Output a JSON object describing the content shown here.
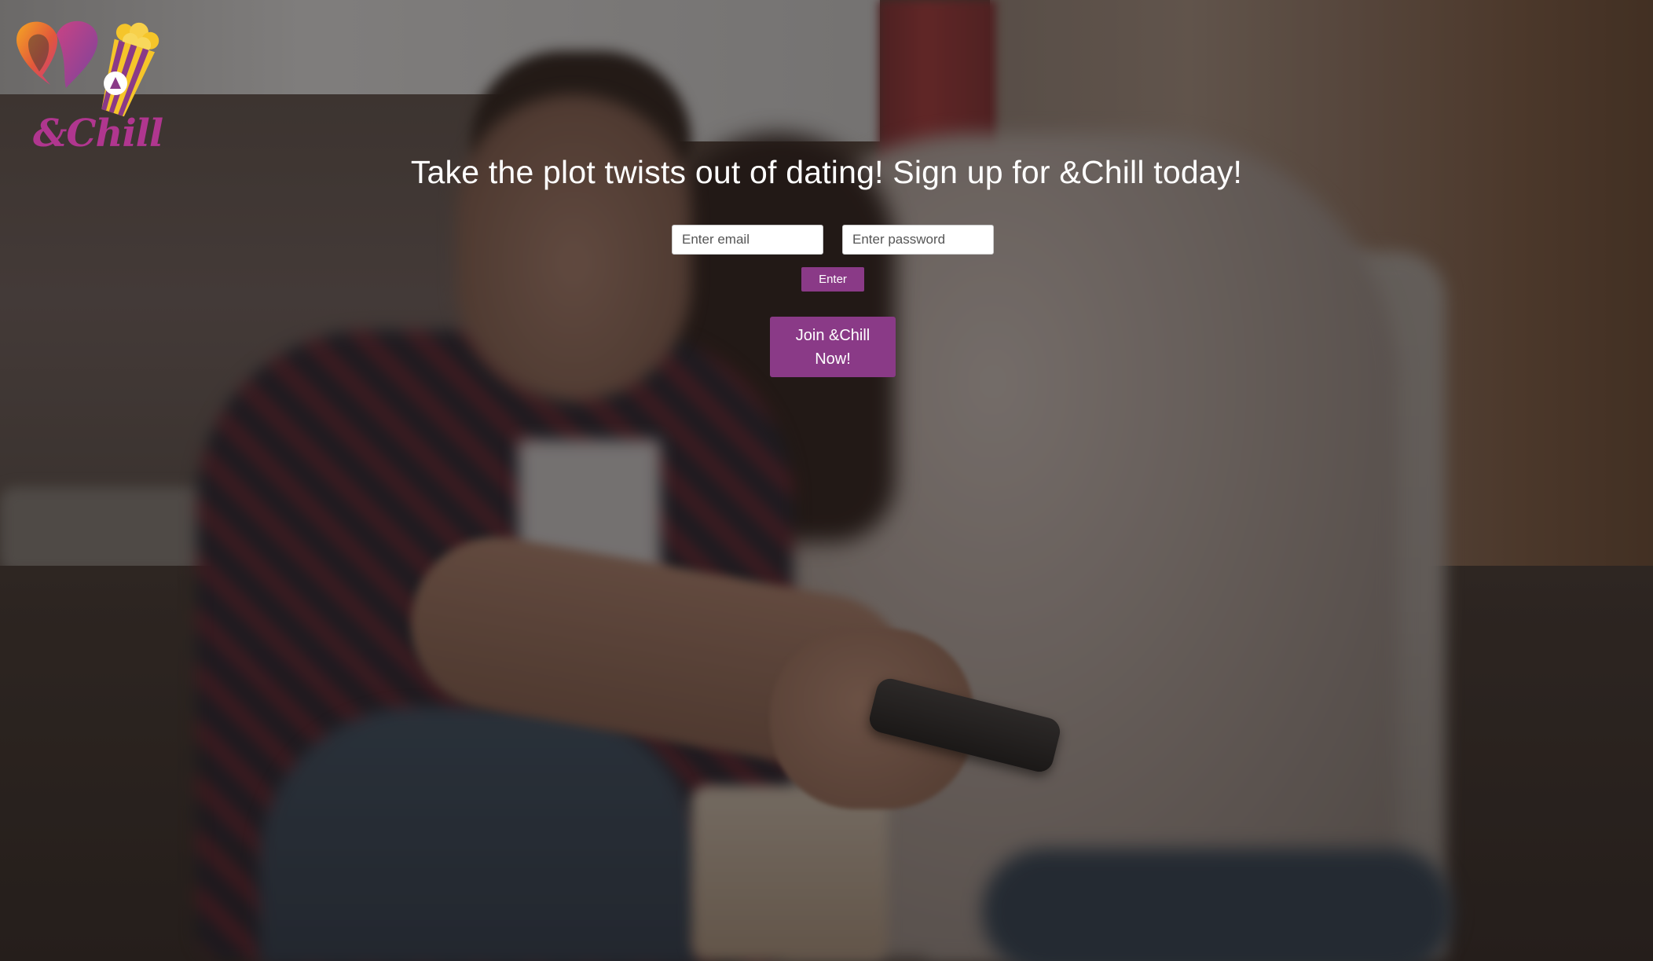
{
  "brand": {
    "logo_text": "&Chill",
    "logo_icons": [
      "heart-icon",
      "popcorn-icon",
      "play-icon"
    ]
  },
  "hero": {
    "headline": "Take the plot twists out of dating! Sign up for &Chill today!"
  },
  "login_form": {
    "email_placeholder": "Enter email",
    "email_value": "",
    "password_placeholder": "Enter password",
    "password_value": "",
    "enter_label": "Enter"
  },
  "signup": {
    "join_label": "Join &Chill Now!"
  },
  "colors": {
    "accent": "#8a3a87",
    "headline_text": "#ffffff",
    "logo_orange": "#f08a24",
    "logo_pink": "#d23e8c",
    "logo_purple": "#7b3fa0",
    "logo_yellow": "#f5c52a"
  }
}
